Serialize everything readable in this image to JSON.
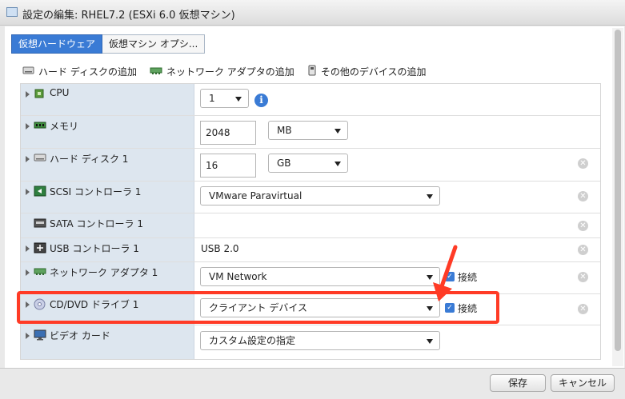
{
  "window": {
    "title": "設定の編集: RHEL7.2 (ESXi 6.0 仮想マシン)"
  },
  "tabs": [
    {
      "label": "仮想ハードウェア",
      "active": true
    },
    {
      "label": "仮想マシン オプシ...",
      "active": false
    }
  ],
  "toolbar": {
    "add_disk": "ハード ディスクの追加",
    "add_nic": "ネットワーク アダプタの追加",
    "add_other": "その他のデバイスの追加"
  },
  "devices": {
    "cpu": {
      "label": "CPU",
      "value": "1"
    },
    "memory": {
      "label": "メモリ",
      "value": "2048",
      "unit": "MB"
    },
    "disk": {
      "label": "ハード ディスク 1",
      "value": "16",
      "unit": "GB"
    },
    "scsi": {
      "label": "SCSI コントローラ 1",
      "value": "VMware Paravirtual"
    },
    "sata": {
      "label": "SATA コントローラ 1"
    },
    "usb": {
      "label": "USB コントローラ 1",
      "value": "USB 2.0"
    },
    "nic": {
      "label": "ネットワーク アダプタ 1",
      "value": "VM Network",
      "connect_label": "接続"
    },
    "cddvd": {
      "label": "CD/DVD ドライブ 1",
      "value": "クライアント デバイス",
      "connect_label": "接続"
    },
    "video": {
      "label": "ビデオ カード",
      "value": "カスタム設定の指定"
    }
  },
  "footer": {
    "save_label": "保存",
    "cancel_label": "キャンセル"
  },
  "colors": {
    "accent": "#3a7bd5",
    "highlight": "#ff3b26",
    "label_bg": "#dde6ef"
  }
}
